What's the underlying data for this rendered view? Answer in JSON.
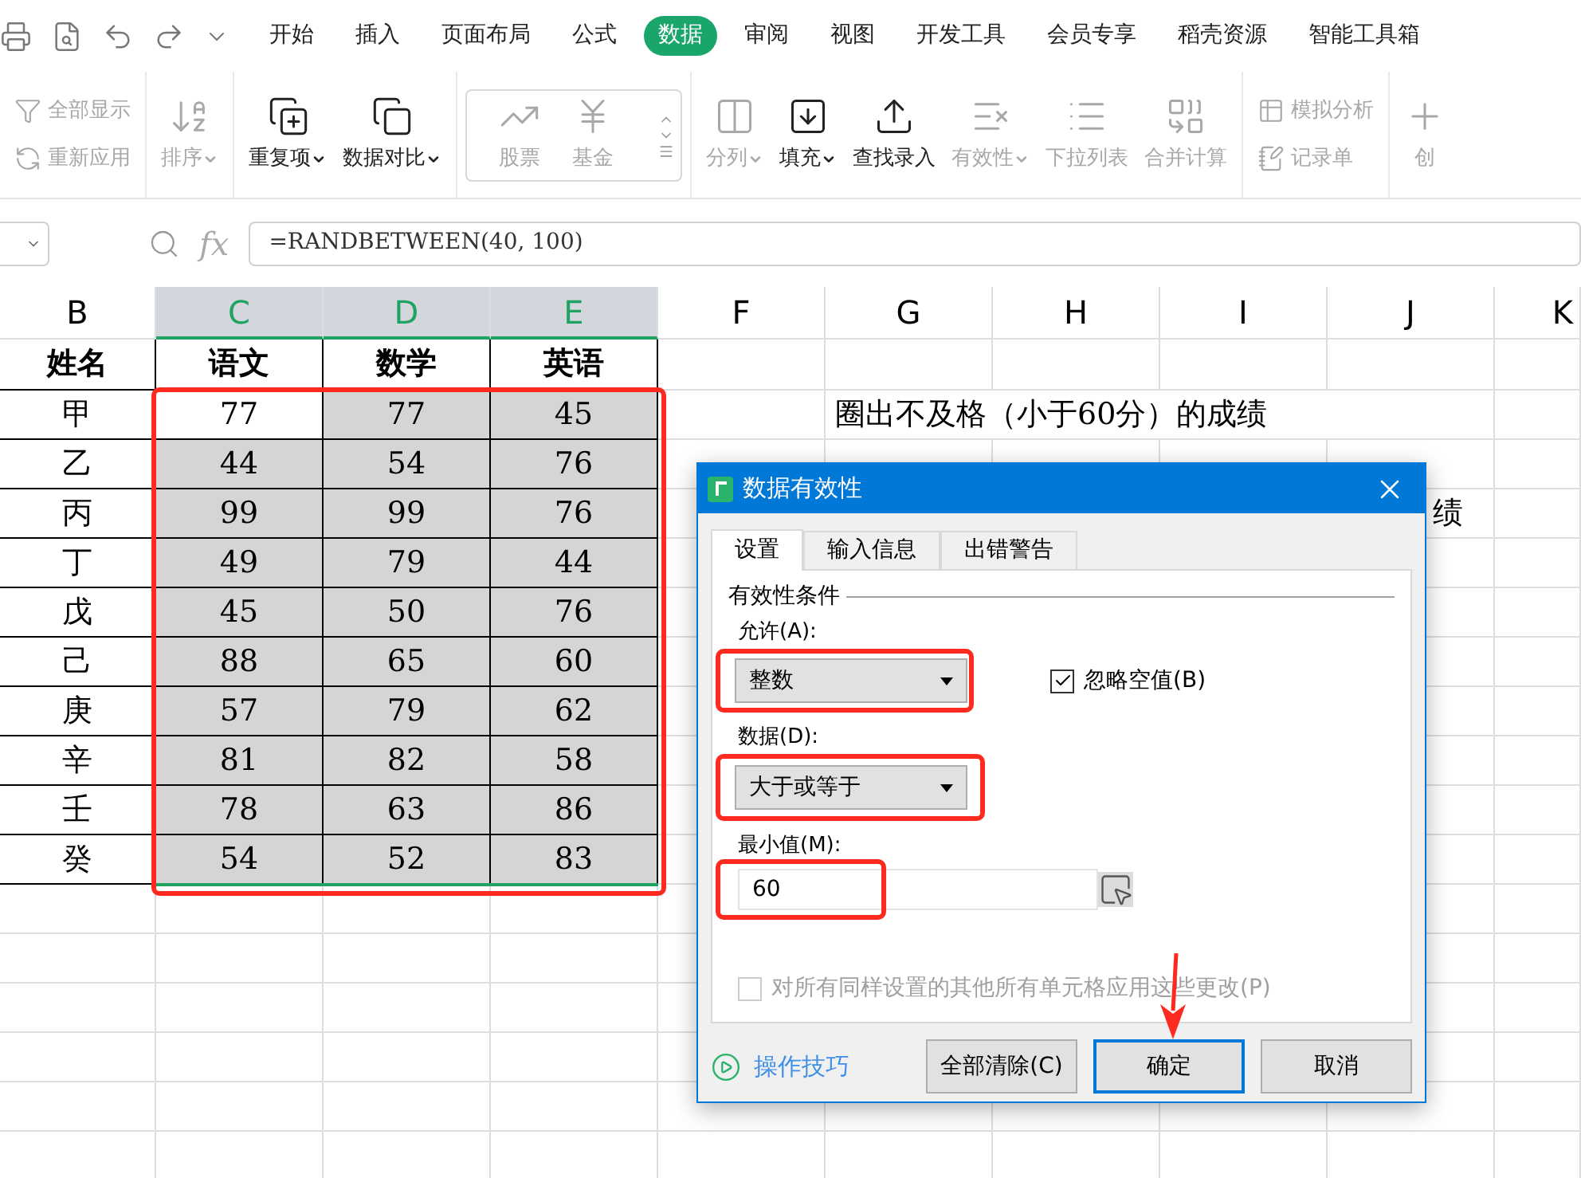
{
  "menu_tabs": [
    {
      "label": "开始",
      "selected": false
    },
    {
      "label": "插入",
      "selected": false
    },
    {
      "label": "页面布局",
      "selected": false
    },
    {
      "label": "公式",
      "selected": false
    },
    {
      "label": "数据",
      "selected": true
    },
    {
      "label": "审阅",
      "selected": false
    },
    {
      "label": "视图",
      "selected": false
    },
    {
      "label": "开发工具",
      "selected": false
    },
    {
      "label": "会员专享",
      "selected": false
    },
    {
      "label": "稻壳资源",
      "selected": false
    },
    {
      "label": "智能工具箱",
      "selected": false
    }
  ],
  "ribbon_groups": [
    {
      "kind": "stack",
      "items": [
        {
          "label": "全部显示",
          "disabled": true,
          "dropdown": false
        },
        {
          "label": "重新应用",
          "disabled": true,
          "dropdown": false
        }
      ]
    },
    {
      "kind": "row",
      "items": [
        {
          "label": "排序",
          "disabled": true,
          "dropdown": true
        }
      ]
    },
    {
      "kind": "row",
      "items": [
        {
          "label": "重复项",
          "disabled": false,
          "dropdown": true
        },
        {
          "label": "数据对比",
          "disabled": false,
          "dropdown": true
        }
      ]
    },
    {
      "kind": "gallery",
      "items": [
        {
          "label": "股票",
          "disabled": true,
          "dropdown": false
        },
        {
          "label": "基金",
          "disabled": true,
          "dropdown": false
        }
      ]
    },
    {
      "kind": "row",
      "items": [
        {
          "label": "分列",
          "disabled": true,
          "dropdown": true
        },
        {
          "label": "填充",
          "disabled": false,
          "dropdown": true
        },
        {
          "label": "查找录入",
          "disabled": false,
          "dropdown": false
        },
        {
          "label": "有效性",
          "disabled": true,
          "dropdown": true
        },
        {
          "label": "下拉列表",
          "disabled": true,
          "dropdown": false
        },
        {
          "label": "合并计算",
          "disabled": true,
          "dropdown": false
        }
      ]
    },
    {
      "kind": "stack",
      "items": [
        {
          "label": "模拟分析",
          "disabled": true,
          "dropdown": false
        },
        {
          "label": "记录单",
          "disabled": true,
          "dropdown": false
        }
      ]
    },
    {
      "kind": "row",
      "items": [
        {
          "label": "创",
          "disabled": true,
          "dropdown": false
        }
      ]
    }
  ],
  "formula_bar": {
    "function_label": "fx",
    "formula": "=RANDBETWEEN(40, 100)"
  },
  "sheet": {
    "columns": [
      {
        "label": "B",
        "selected": false
      },
      {
        "label": "C",
        "selected": true
      },
      {
        "label": "D",
        "selected": true
      },
      {
        "label": "E",
        "selected": true
      },
      {
        "label": "F",
        "selected": false
      },
      {
        "label": "G",
        "selected": false
      },
      {
        "label": "H",
        "selected": false
      },
      {
        "label": "I",
        "selected": false
      },
      {
        "label": "J",
        "selected": false
      },
      {
        "label": "K",
        "selected": false
      }
    ],
    "header": [
      "姓名",
      "语文",
      "数学",
      "英语"
    ],
    "rows": [
      {
        "name": "甲",
        "scores": [
          {
            "value": "77",
            "selected": false
          },
          {
            "value": "77",
            "selected": true
          },
          {
            "value": "45",
            "selected": true
          }
        ]
      },
      {
        "name": "乙",
        "scores": [
          {
            "value": "44",
            "selected": true
          },
          {
            "value": "54",
            "selected": true
          },
          {
            "value": "76",
            "selected": true
          }
        ]
      },
      {
        "name": "丙",
        "scores": [
          {
            "value": "99",
            "selected": true
          },
          {
            "value": "99",
            "selected": true
          },
          {
            "value": "76",
            "selected": true
          }
        ]
      },
      {
        "name": "丁",
        "scores": [
          {
            "value": "49",
            "selected": true
          },
          {
            "value": "79",
            "selected": true
          },
          {
            "value": "44",
            "selected": true
          }
        ]
      },
      {
        "name": "戊",
        "scores": [
          {
            "value": "45",
            "selected": true
          },
          {
            "value": "50",
            "selected": true
          },
          {
            "value": "76",
            "selected": true
          }
        ]
      },
      {
        "name": "己",
        "scores": [
          {
            "value": "88",
            "selected": true
          },
          {
            "value": "65",
            "selected": true
          },
          {
            "value": "60",
            "selected": true
          }
        ]
      },
      {
        "name": "庚",
        "scores": [
          {
            "value": "57",
            "selected": true
          },
          {
            "value": "79",
            "selected": true
          },
          {
            "value": "62",
            "selected": true
          }
        ]
      },
      {
        "name": "辛",
        "scores": [
          {
            "value": "81",
            "selected": true
          },
          {
            "value": "82",
            "selected": true
          },
          {
            "value": "58",
            "selected": true
          }
        ]
      },
      {
        "name": "壬",
        "scores": [
          {
            "value": "78",
            "selected": true
          },
          {
            "value": "63",
            "selected": true
          },
          {
            "value": "86",
            "selected": true
          }
        ]
      },
      {
        "name": "癸",
        "scores": [
          {
            "value": "54",
            "selected": true
          },
          {
            "value": "52",
            "selected": true
          },
          {
            "value": "83",
            "selected": true
          }
        ]
      }
    ],
    "note": "圈出不及格（小于60分）的成绩",
    "note_partial": "绩"
  },
  "dialog": {
    "title": "数据有效性",
    "tabs": [
      {
        "label": "设置",
        "selected": true
      },
      {
        "label": "输入信息",
        "selected": false
      },
      {
        "label": "出错警告",
        "selected": false
      }
    ],
    "group_label": "有效性条件",
    "allow": {
      "label": "允许(A):",
      "value": "整数"
    },
    "ignore_blank": {
      "label": "忽略空值(B)",
      "checked": true
    },
    "data": {
      "label": "数据(D):",
      "value": "大于或等于"
    },
    "minimum": {
      "label": "最小值(M):",
      "value": "60"
    },
    "apply_all": {
      "label": "对所有同样设置的其他所有单元格应用这些更改(P)",
      "checked": false,
      "disabled": true
    },
    "tips_link": "操作技巧",
    "buttons": [
      {
        "label": "全部清除(C)",
        "default": false
      },
      {
        "label": "确定",
        "default": true
      },
      {
        "label": "取消",
        "default": false
      }
    ]
  }
}
